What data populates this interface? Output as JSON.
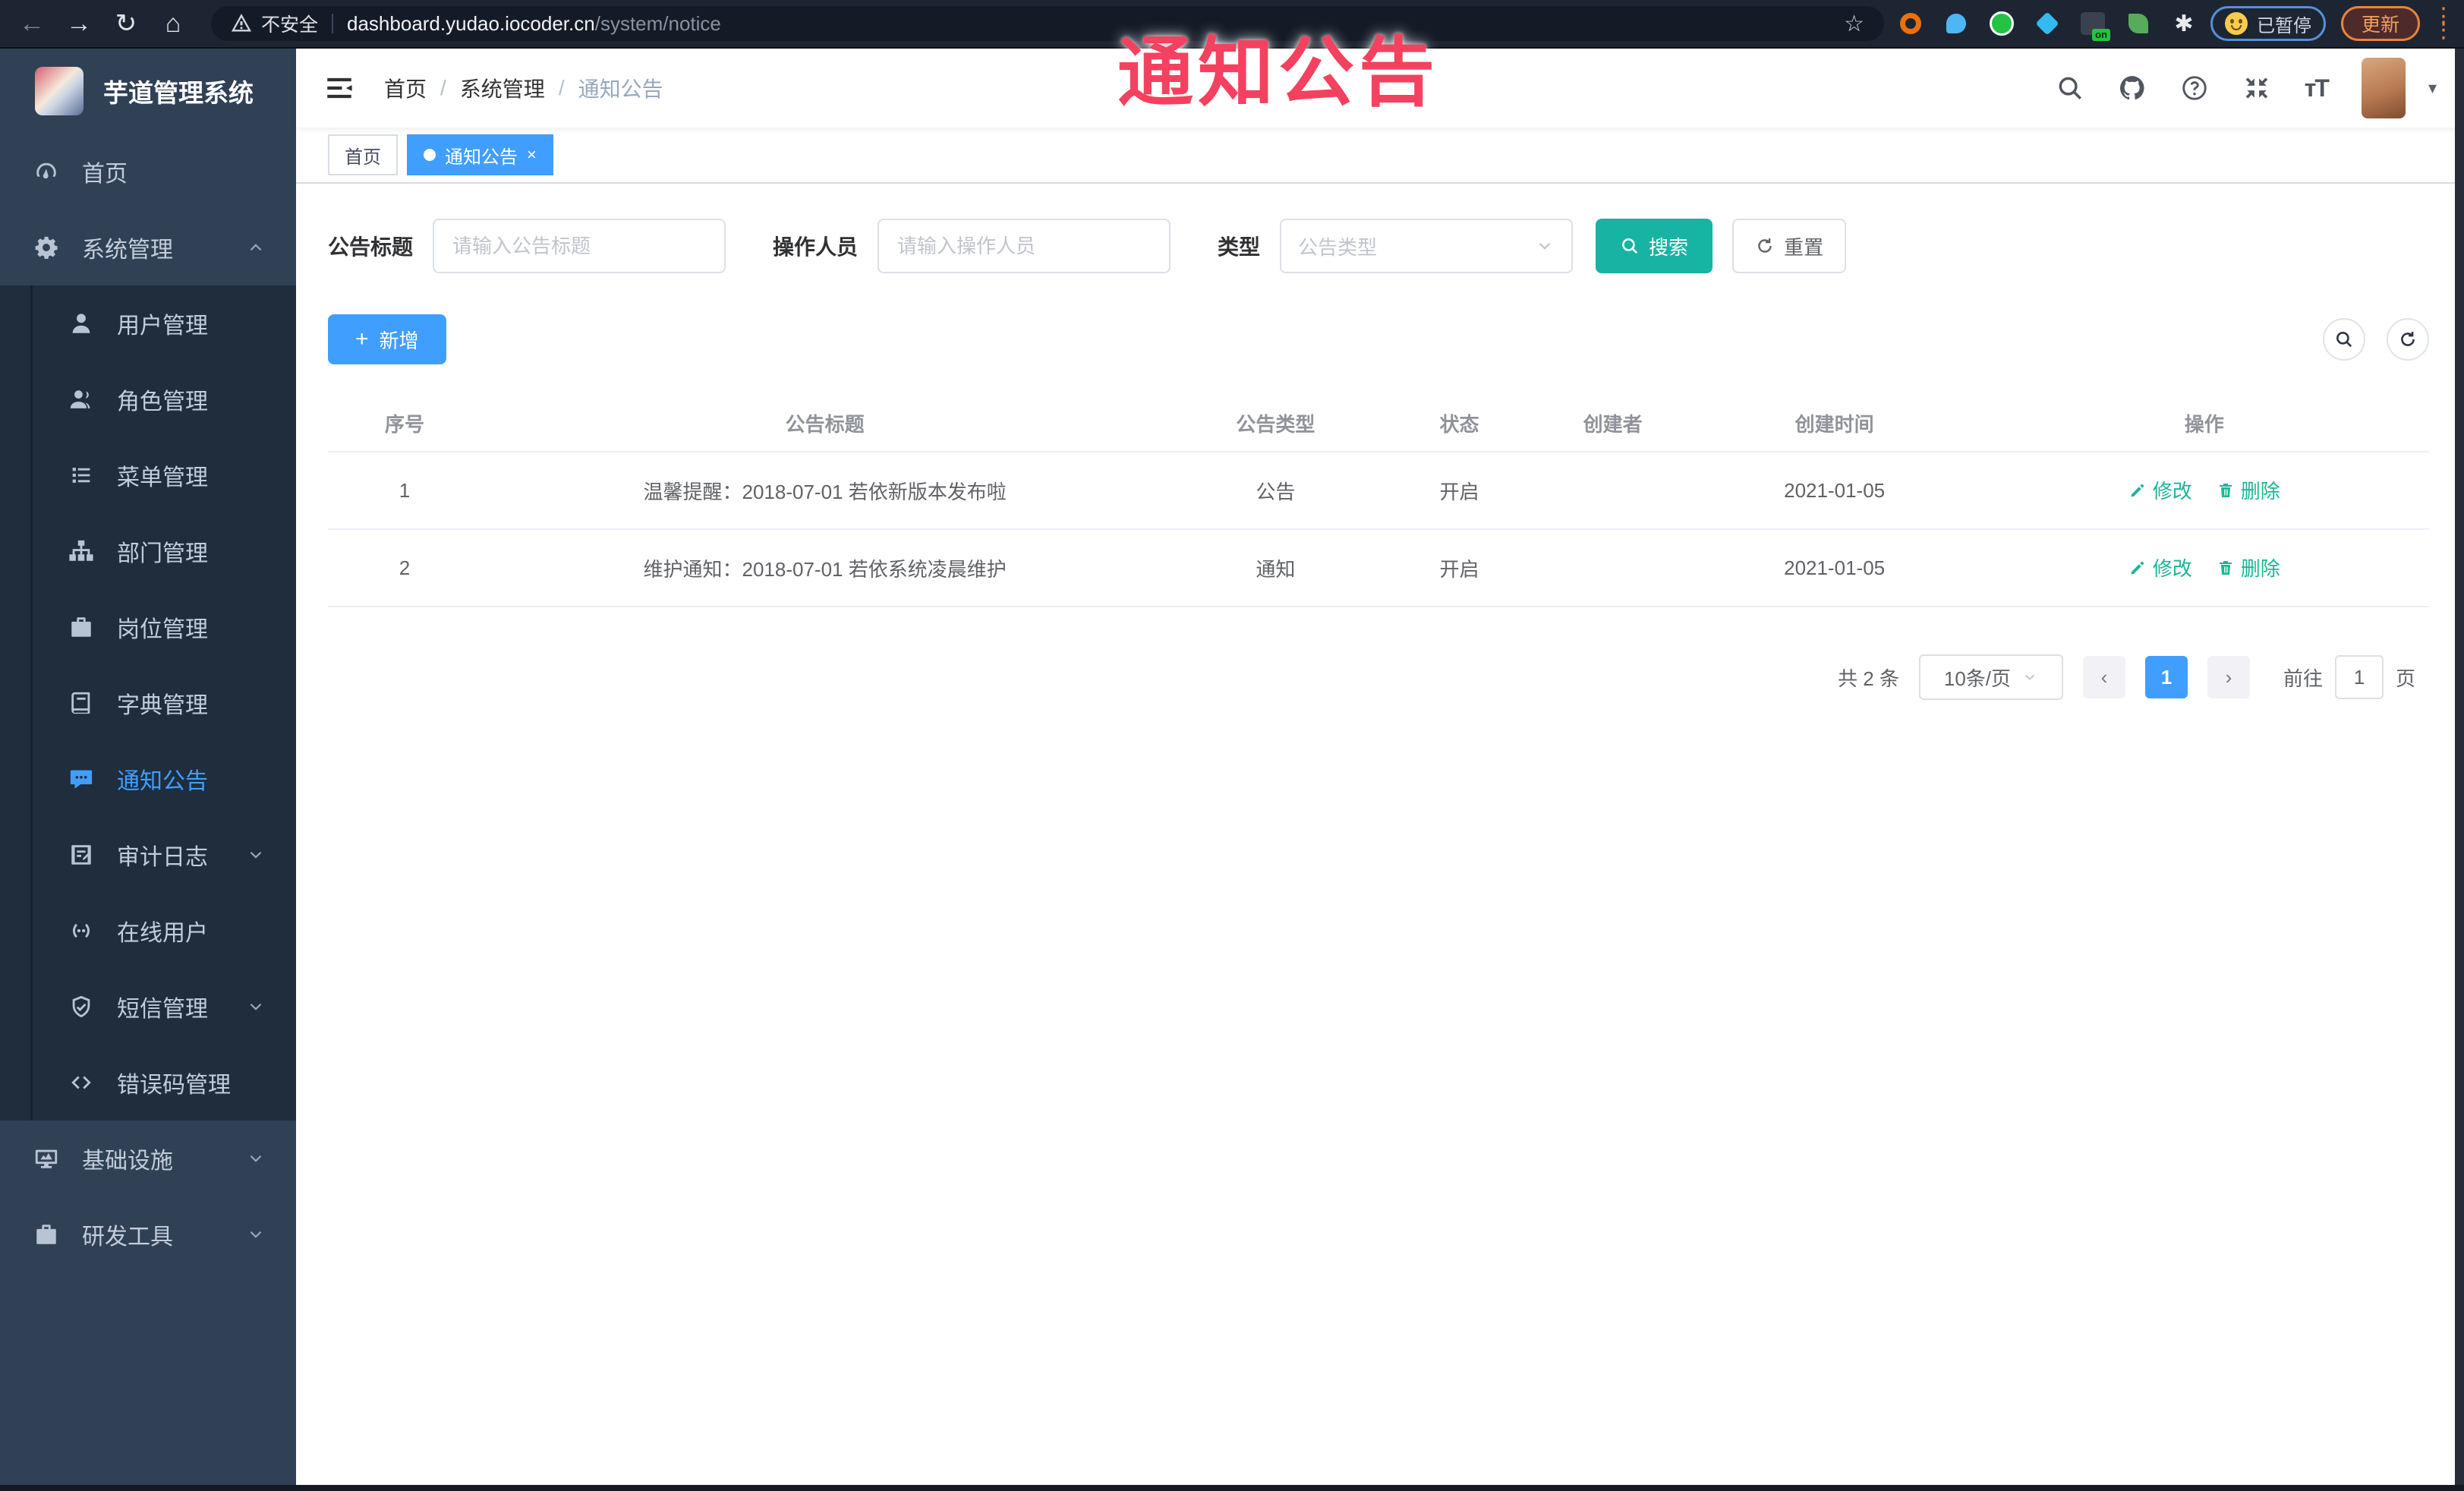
{
  "overlay": {
    "label": "通知公告"
  },
  "browser": {
    "warning_text": "不安全",
    "url_host": "dashboard.yudao.iocoder.cn",
    "url_path": "/system/notice",
    "ext_on_badge": "on",
    "paused_label": "已暂停",
    "update_label": "更新"
  },
  "sidebar": {
    "title": "芋道管理系统",
    "menu": [
      {
        "key": "home",
        "label": "首页",
        "icon": "dashboard",
        "type": "root"
      },
      {
        "key": "system",
        "label": "系统管理",
        "icon": "gear",
        "type": "root",
        "arrow": "up"
      },
      {
        "key": "user",
        "label": "用户管理",
        "icon": "user",
        "type": "sub"
      },
      {
        "key": "role",
        "label": "角色管理",
        "icon": "role",
        "type": "sub"
      },
      {
        "key": "menu",
        "label": "菜单管理",
        "icon": "menu-list",
        "type": "sub"
      },
      {
        "key": "dept",
        "label": "部门管理",
        "icon": "org-tree",
        "type": "sub"
      },
      {
        "key": "post",
        "label": "岗位管理",
        "icon": "post",
        "type": "sub"
      },
      {
        "key": "dict",
        "label": "字典管理",
        "icon": "dict",
        "type": "sub"
      },
      {
        "key": "notice",
        "label": "通知公告",
        "icon": "notice",
        "type": "sub",
        "active": true
      },
      {
        "key": "audit-log",
        "label": "审计日志",
        "icon": "audit",
        "type": "sub",
        "arrow": "down"
      },
      {
        "key": "online-user",
        "label": "在线用户",
        "icon": "online",
        "type": "sub"
      },
      {
        "key": "sms",
        "label": "短信管理",
        "icon": "sms",
        "type": "sub",
        "arrow": "down"
      },
      {
        "key": "error-code",
        "label": "错误码管理",
        "icon": "code",
        "type": "sub"
      },
      {
        "key": "infra",
        "label": "基础设施",
        "icon": "infra",
        "type": "root",
        "arrow": "down"
      },
      {
        "key": "dev-tools",
        "label": "研发工具",
        "icon": "tools",
        "type": "root",
        "arrow": "down"
      }
    ]
  },
  "navbar": {
    "breadcrumb": [
      "首页",
      "系统管理",
      "通知公告"
    ]
  },
  "tabs": [
    {
      "label": "首页",
      "active": false
    },
    {
      "label": "通知公告",
      "active": true
    }
  ],
  "filters": {
    "title_label": "公告标题",
    "title_placeholder": "请输入公告标题",
    "operator_label": "操作人员",
    "operator_placeholder": "请输入操作人员",
    "type_label": "类型",
    "type_placeholder": "公告类型",
    "search_label": "搜索",
    "reset_label": "重置"
  },
  "toolbar": {
    "add_label": "新增"
  },
  "table": {
    "headers": [
      "序号",
      "公告标题",
      "公告类型",
      "状态",
      "创建者",
      "创建时间",
      "操作"
    ],
    "rows": [
      {
        "no": "1",
        "title": "温馨提醒：2018-07-01 若依新版本发布啦",
        "type": "公告",
        "status": "开启",
        "creator": "",
        "created": "2021-01-05"
      },
      {
        "no": "2",
        "title": "维护通知：2018-07-01 若依系统凌晨维护",
        "type": "通知",
        "status": "开启",
        "creator": "",
        "created": "2021-01-05"
      }
    ],
    "edit_label": "修改",
    "delete_label": "删除"
  },
  "pagination": {
    "total": "共 2 条",
    "page_size": "10条/页",
    "current": "1",
    "goto_label": "前往",
    "goto_value": "1",
    "goto_suffix": "页"
  },
  "colors": {
    "accent": "#409eff",
    "search_button": "#17b3a3",
    "action_link": "#1db596",
    "overlay_red": "#f4415f",
    "sidebar_bg": "#304156",
    "submenu_bg": "#1f2d3d"
  }
}
